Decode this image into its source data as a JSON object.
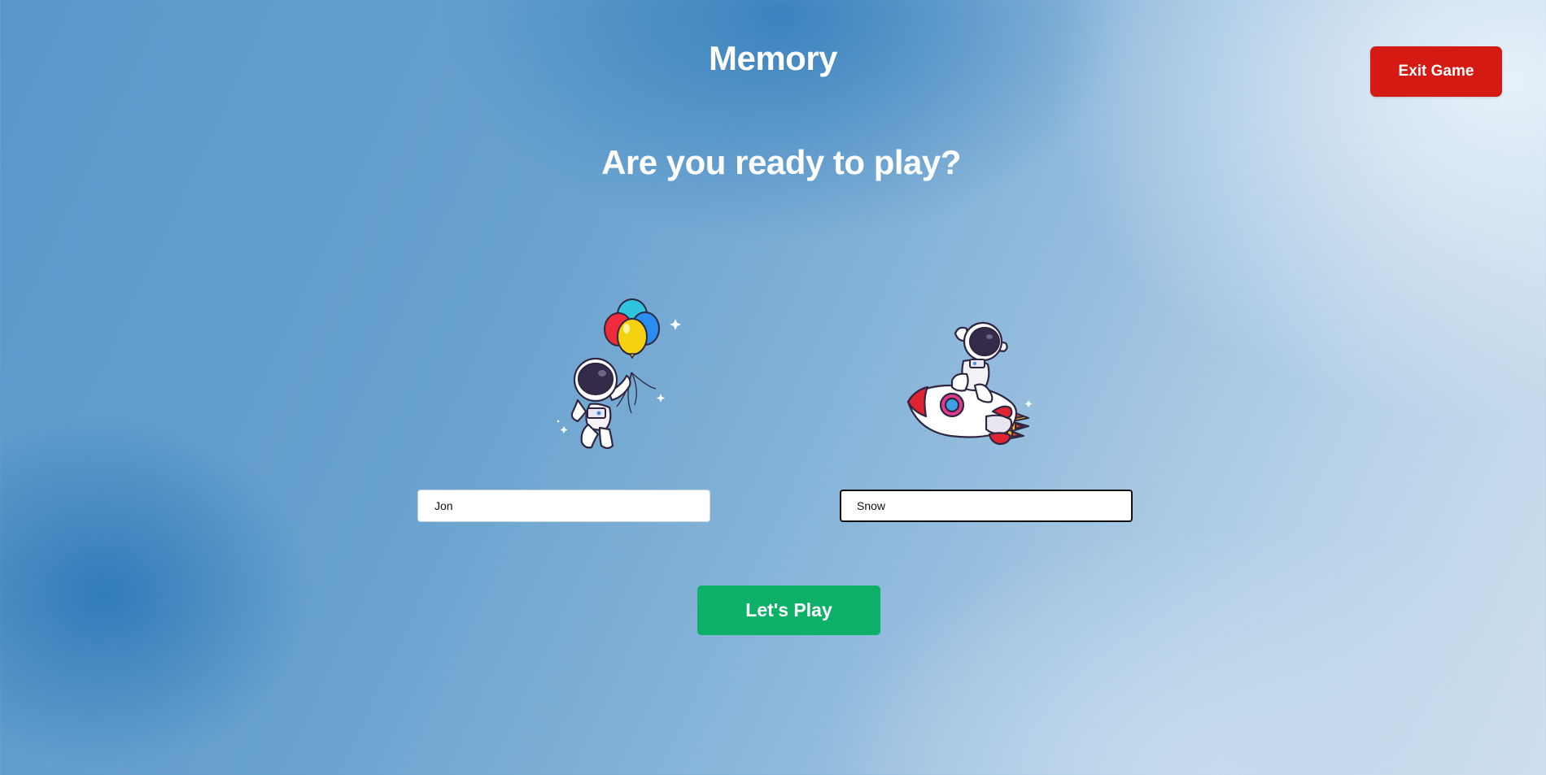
{
  "header": {
    "title": "Memory",
    "subtitle": "Are you ready to play?",
    "exit_label": "Exit Game"
  },
  "players": [
    {
      "avatar": "astronaut-balloons-icon",
      "name_value": "Jon"
    },
    {
      "avatar": "astronaut-rocket-icon",
      "name_value": "Snow"
    }
  ],
  "play_label": "Let's Play",
  "colors": {
    "exit_button": "#d41a12",
    "play_button": "#0db068",
    "text": "#ffffff"
  }
}
